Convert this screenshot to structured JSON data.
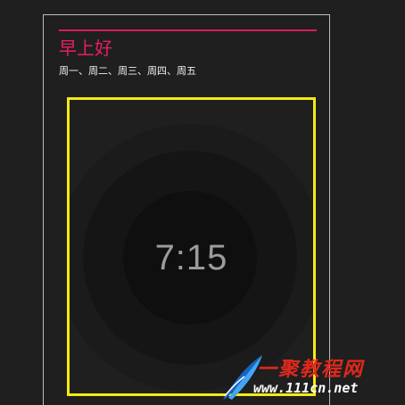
{
  "tile": {
    "greeting": "早上好",
    "weekdays": "周一、周二、周三、周四、周五",
    "time": "7:15"
  },
  "watermark": {
    "name": "一聚教程网",
    "url": "www.111cn.net"
  },
  "colors": {
    "background": "#1f1f1f",
    "accent": "#e91e63",
    "highlight_border": "#f4ea14",
    "time_text": "#9c9c9c",
    "card_border": "#bdbdbd"
  }
}
